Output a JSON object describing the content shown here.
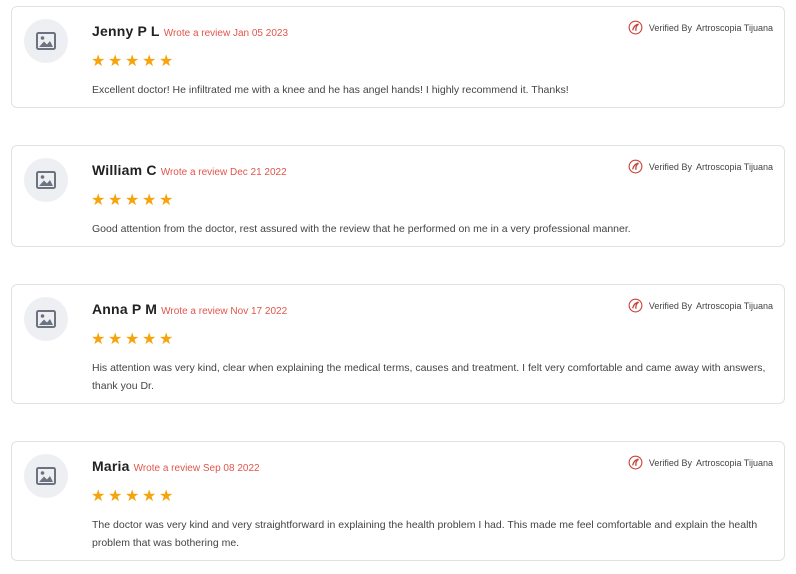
{
  "verified_label": "Verified By",
  "verified_source": "Artroscopia Tijuana",
  "avatar_icon": "image-placeholder-icon",
  "verified_icon": "clinic-logo-icon",
  "star_icon": "star-icon",
  "colors": {
    "star": "#f5a40c",
    "date": "#e0564b",
    "border": "#e2e2e2",
    "avatar_bg": "#eeeff2"
  },
  "reviews": [
    {
      "name": "Jenny P L",
      "date_text": "Wrote a review Jan 05 2023",
      "rating": 5,
      "text": "Excellent doctor! He infiltrated me with a knee and he has angel hands! I highly recommend it. Thanks!"
    },
    {
      "name": "William C",
      "date_text": "Wrote a review Dec 21 2022",
      "rating": 5,
      "text": "Good attention from the doctor, rest assured with the review that he performed on me in a very professional manner."
    },
    {
      "name": "Anna P M",
      "date_text": "Wrote a review Nov 17 2022",
      "rating": 5,
      "text": "His attention was very kind, clear when explaining the medical terms, causes and treatment. I felt very comfortable and came away with answers, thank you Dr."
    },
    {
      "name": "Maria",
      "date_text": "Wrote a review Sep 08 2022",
      "rating": 5,
      "text": "The doctor was very kind and very straightforward in explaining the health problem I had. This made me feel comfortable and explain the health problem that was bothering me."
    }
  ]
}
